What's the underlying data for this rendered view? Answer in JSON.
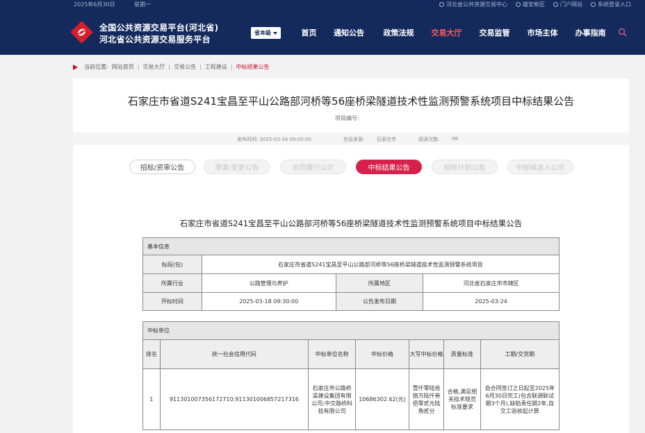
{
  "topbar": {
    "date": "2025年6月30日",
    "week": "星期一",
    "links": [
      "河北省公共资源交易中心",
      "雄安新区",
      "门户网站",
      "系统登录入口"
    ]
  },
  "brand": {
    "title_line1": "全国公共资源交易平台(河北省)",
    "title_line2": "河北省公共资源交易服务平台",
    "level_label": "省本级"
  },
  "nav": {
    "items": [
      "首页",
      "通知公告",
      "政策法规",
      "交易大厅",
      "交易监管",
      "市场主体",
      "办事指南"
    ],
    "active_index": 3
  },
  "breadcrumb": {
    "prefix": "当前位置:",
    "items": [
      "网站首页",
      "交易大厅",
      "交易公告",
      "工程建设",
      "中标结果公告"
    ]
  },
  "article": {
    "title": "石家庄市省道S241宝昌至平山公路部河桥等56座桥梁隧道技术性监测预警系统项目中标结果公告",
    "project_no_label": "项目编号:",
    "publish_time": "发布时间: 2025-03-24 09:00:00",
    "source_label": "信息来源:",
    "source_value": "石家庄市",
    "views_label": "阅读次数:",
    "views_value": "98"
  },
  "tabs": [
    "招标/资审公告",
    "澄清/变更公告",
    "合同履行公示",
    "中标结果公告",
    "招标计划公告",
    "中标候选人公示"
  ],
  "doc": {
    "title": "石家庄市省道S241宝昌至平山公路部河桥等56座桥梁隧道技术性监测预警系统项目中标结果公告",
    "basic": {
      "section": "基本信息",
      "section_label": "标段(包)",
      "section_value": "石家庄市省道S241宝昌至平山公路部河桥等56座桥梁隧道技术性监测预警系统项目",
      "industry_label": "所属行业",
      "industry_value": "公路管理与养护",
      "region_label": "所属地区",
      "region_value": "河北省石家庄市市辖区",
      "open_label": "开标时间",
      "open_value": "2025-03-18 09:30:00",
      "notice_label": "公告发布日期",
      "notice_value": "2025-03-24"
    },
    "winner": {
      "section": "中标单位",
      "headers": [
        "排名",
        "统一社会信用代码",
        "中标单位名称",
        "中标价格",
        "大写中标价格",
        "质量标准",
        "工期/交货期"
      ],
      "rows": [
        {
          "rank": "1",
          "code": "911301007356172710;911301006857217316",
          "name": "石家庄市公路桥梁建设集团有限公司;中交路桥科技有限公司",
          "price": "10686302.62(元)",
          "price_cn": "壹仟零陆拾捌万陆仟叁佰零贰元陆角贰分",
          "quality": "合格,满足相关技术规范标准要求",
          "period": "自合同签订之日起至2025年6月30日完工(包含联调联试期3个月),缺陷责任期2年,自交工验收起计算"
        }
      ]
    }
  },
  "colors": {
    "header_bg": "#142a5c",
    "accent_red": "#d6224b",
    "nav_active": "#ff5a5a"
  }
}
